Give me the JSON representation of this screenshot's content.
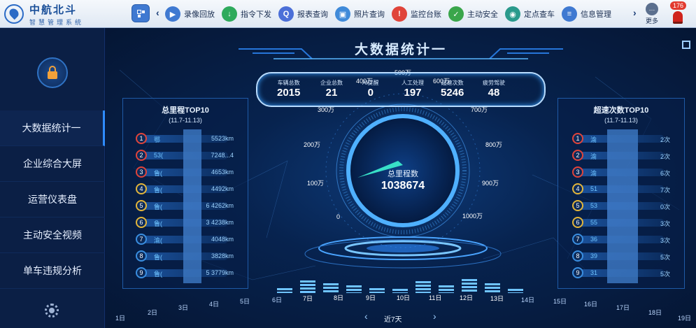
{
  "app": {
    "title": "中航北斗",
    "subtitle": "智慧管理系统"
  },
  "topmenu": [
    {
      "label": "录像回放",
      "icon": "video-playback-icon",
      "color": "#3f79d1",
      "glyph": "▶"
    },
    {
      "label": "指令下发",
      "icon": "command-icon",
      "color": "#2eaa5c",
      "glyph": "↓"
    },
    {
      "label": "报表查询",
      "icon": "search-icon",
      "color": "#4b6fd8",
      "glyph": "Q"
    },
    {
      "label": "照片查询",
      "icon": "photo-icon",
      "color": "#3f8ad9",
      "glyph": "▣"
    },
    {
      "label": "监控台账",
      "icon": "alert-icon",
      "color": "#e0443a",
      "glyph": "!"
    },
    {
      "label": "主动安全",
      "icon": "shield-icon",
      "color": "#3aa64b",
      "glyph": "✓"
    },
    {
      "label": "定点查车",
      "icon": "car-icon",
      "color": "#2a9a8c",
      "glyph": "◉"
    },
    {
      "label": "信息管理",
      "icon": "info-icon",
      "color": "#3f79d1",
      "glyph": "≡"
    }
  ],
  "more_label": "更多",
  "alarm_count": "176",
  "sidebar": {
    "items": [
      {
        "label": "大数据统计一",
        "active": true
      },
      {
        "label": "企业综合大屏",
        "active": false
      },
      {
        "label": "运营仪表盘",
        "active": false
      },
      {
        "label": "主动安全视频",
        "active": false
      },
      {
        "label": "单车违规分析",
        "active": false
      }
    ]
  },
  "main": {
    "title": "大数据统计一",
    "stats": [
      {
        "label": "车辆总数",
        "value": "2015"
      },
      {
        "label": "企业总数",
        "value": "21"
      },
      {
        "label": "AI提醒",
        "value": "0"
      },
      {
        "label": "人工处理",
        "value": "197"
      },
      {
        "label": "超速次数",
        "value": "5246"
      },
      {
        "label": "疲劳驾驶",
        "value": "48"
      }
    ],
    "gauge": {
      "center_label": "总里程数",
      "center_value": "1038674",
      "scale": [
        "0",
        "100万",
        "200万",
        "300万",
        "400万",
        "500万",
        "600万",
        "700万",
        "800万",
        "900万",
        "1000万"
      ]
    },
    "left_panel": {
      "title": "总里程TOP10",
      "range": "(11.7-11.13)",
      "rows": [
        {
          "rank": "1",
          "name": "鄂",
          "value": "5523km"
        },
        {
          "rank": "2",
          "name": "53(",
          "value": "7248...4"
        },
        {
          "rank": "3",
          "name": "鲁(",
          "value": "4653km"
        },
        {
          "rank": "4",
          "name": "鲁(",
          "value": "4492km"
        },
        {
          "rank": "5",
          "name": "鲁(",
          "value": "6 4262km"
        },
        {
          "rank": "6",
          "name": "鲁(",
          "value": "3 4238km"
        },
        {
          "rank": "7",
          "name": "渝(",
          "value": "4048km"
        },
        {
          "rank": "8",
          "name": "鲁(",
          "value": "3828km"
        },
        {
          "rank": "9",
          "name": "鲁(",
          "value": "5 3779km"
        }
      ]
    },
    "right_panel": {
      "title": "超速次数TOP10",
      "range": "(11.7-11.13)",
      "rows": [
        {
          "rank": "1",
          "name": "渝",
          "value": "2次"
        },
        {
          "rank": "2",
          "name": "渝",
          "value": "2次"
        },
        {
          "rank": "3",
          "name": "渝",
          "value": "6次"
        },
        {
          "rank": "4",
          "name": "51",
          "value": "7次"
        },
        {
          "rank": "5",
          "name": "53",
          "value": "0次"
        },
        {
          "rank": "6",
          "name": "55",
          "value": "3次"
        },
        {
          "rank": "7",
          "name": "36",
          "value": "3次"
        },
        {
          "rank": "8",
          "name": "39",
          "value": "5次"
        },
        {
          "rank": "9",
          "name": "31",
          "value": "5次"
        }
      ]
    },
    "days": [
      "1日",
      "2日",
      "3日",
      "4日",
      "5日",
      "6日",
      "7日",
      "8日",
      "9日",
      "10日",
      "11日",
      "12日",
      "13日",
      "14日",
      "15日",
      "16日",
      "17日",
      "18日",
      "19日"
    ],
    "selected_days": [
      "7日",
      "8日",
      "9日",
      "10日",
      "11日",
      "12日",
      "13日"
    ],
    "range_label": "近7天",
    "bar_levels": [
      0.3,
      0.75,
      0.6,
      0.45,
      0.3,
      0.25,
      0.7,
      0.45,
      0.85,
      0.6,
      0.25
    ]
  },
  "colors": {
    "accent": "#2f8cff",
    "background": "#06163a",
    "rank_red": "#e0443a",
    "rank_gold": "#e3b53a",
    "rank_blue": "#3a8ee0"
  }
}
